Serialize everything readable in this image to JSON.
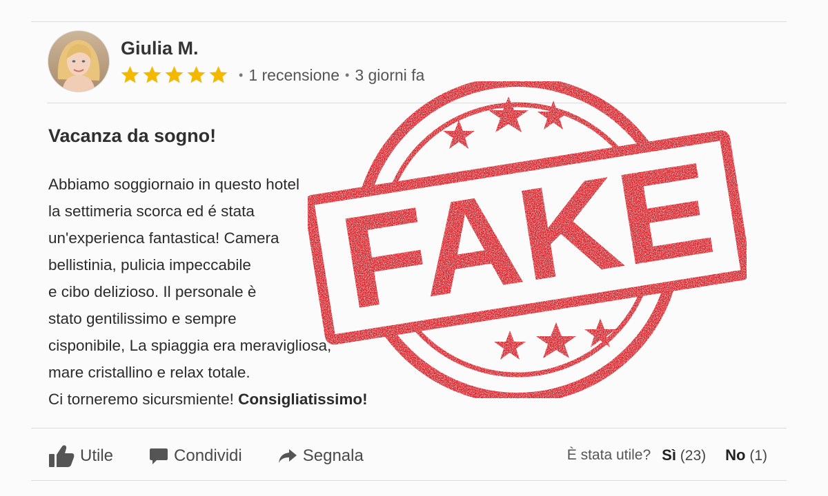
{
  "review": {
    "author": "Giulia M.",
    "rating": 5,
    "review_count": "1 recensione",
    "time_ago": "3 giorni fa",
    "title": "Vacanza da sogno!",
    "body_lines": [
      "Abbiamo soggiornaio in questo hotel",
      "la settimeria scorca ed é stata",
      "un'experienca fantastica! Camera",
      "bellistinia, pulicia impeccabile",
      "e cibo delizioso. Il personale è",
      "stato gentilissimo e sempre",
      "cisponibile, La spiaggia era meravigliosa,",
      "mare cristallino e relax totale.",
      "Ci torneremo sicursmiente!"
    ],
    "body_closing_bold": "Consigliatissimo!"
  },
  "stamp": {
    "text": "FAKE",
    "color": "#d4141c"
  },
  "actions": {
    "useful_label": "Utile",
    "share_label": "Condividi",
    "report_label": "Segnala"
  },
  "helpfulness": {
    "question": "È stata utile?",
    "yes_label": "Sì",
    "yes_count": "(23)",
    "no_label": "No",
    "no_count": "(1)"
  },
  "colors": {
    "star": "#f5b800",
    "stamp_red": "#d4141c",
    "text": "#2b2b2b"
  }
}
